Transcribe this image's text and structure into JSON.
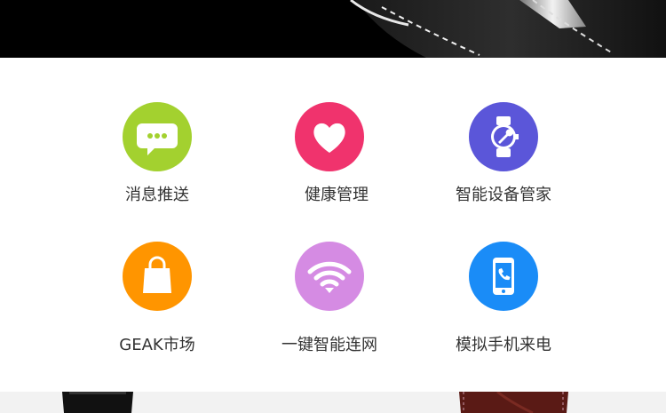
{
  "colors": {
    "messages": "#a3d12f",
    "health": "#f0336d",
    "device": "#5b56d9",
    "market": "#ff9500",
    "wifi": "#d58be3",
    "phone": "#1a8cf7"
  },
  "features": [
    {
      "label": "消息推送",
      "icon": "chat-bubble-icon"
    },
    {
      "label": "健康管理",
      "icon": "heart-icon"
    },
    {
      "label": "智能设备管家",
      "icon": "watch-wrench-icon"
    },
    {
      "label": "GEAK市场",
      "icon": "shopping-bag-icon"
    },
    {
      "label": "一键智能连网",
      "icon": "wifi-icon"
    },
    {
      "label": "模拟手机来电",
      "icon": "phone-call-icon"
    }
  ]
}
